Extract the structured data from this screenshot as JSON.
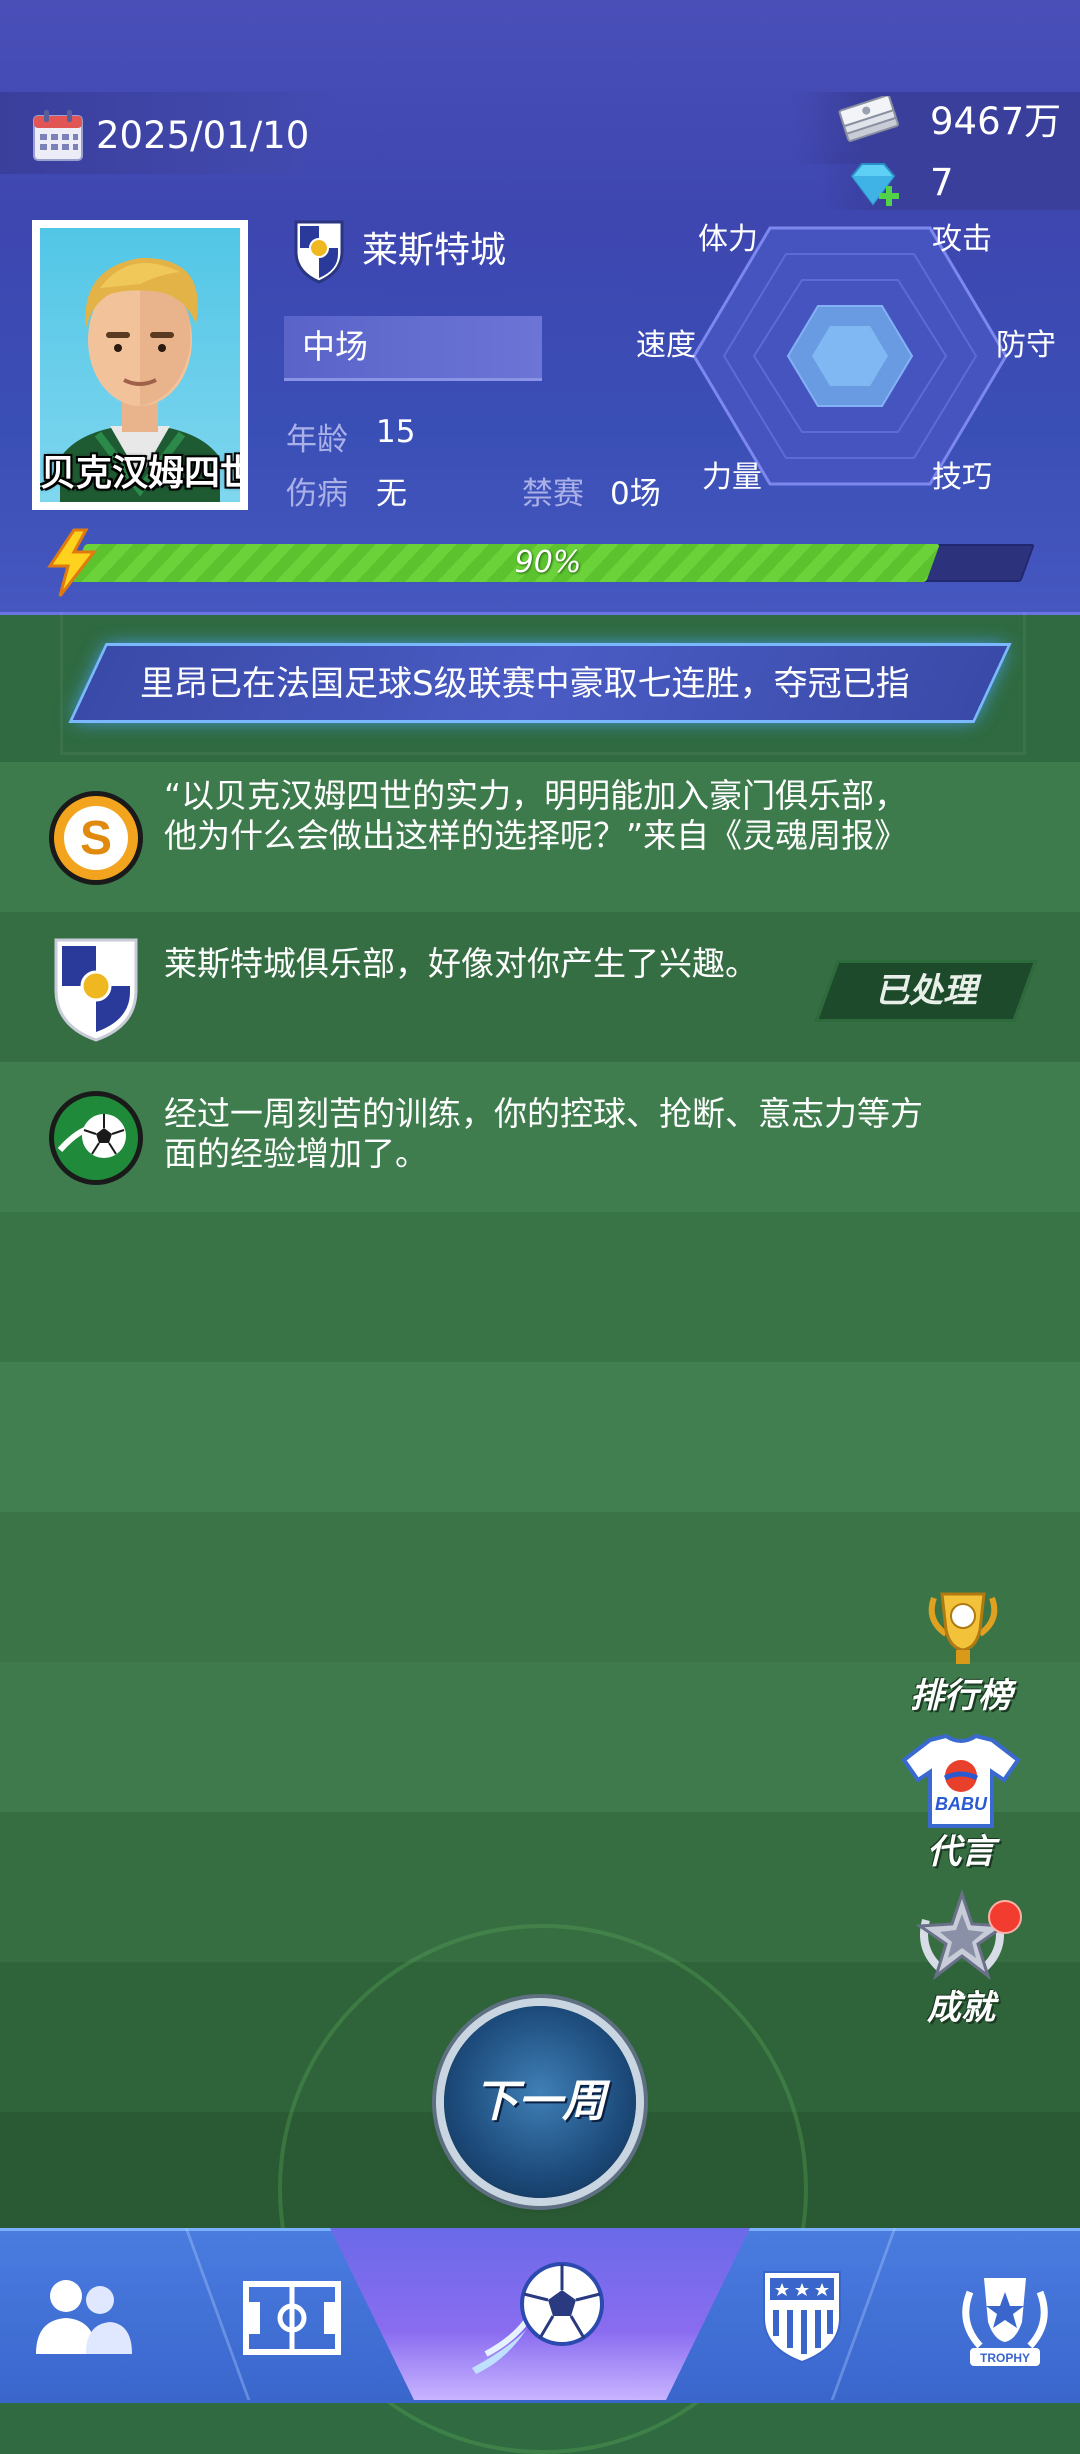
{
  "header": {
    "date": "2025/01/10",
    "cash": "9467万",
    "gems": "7"
  },
  "player": {
    "name": "贝克汉姆四世",
    "club": "莱斯特城",
    "position": "中场",
    "age_label": "年龄",
    "age": "15",
    "injury_label": "伤病",
    "injury": "无",
    "ban_label": "禁赛",
    "ban": "0场",
    "energy_percent": 90,
    "energy_text": "90%"
  },
  "stats": {
    "stamina": "体力",
    "attack": "攻击",
    "speed": "速度",
    "defense": "防守",
    "strength": "力量",
    "skill": "技巧"
  },
  "ticker": {
    "text": "里昂已在法国足球S级联赛中豪取七连胜，夺冠已指"
  },
  "messages": [
    {
      "icon": "s-newspaper-icon",
      "text": "“以贝克汉姆四世的实力，明明能加入豪门俱乐部，他为什么会做出这样的选择呢？”来自《灵魂周报》"
    },
    {
      "icon": "club-crest-icon",
      "text": "莱斯特城俱乐部，好像对你产生了兴趣。",
      "status": "已处理"
    },
    {
      "icon": "soccer-ball-icon",
      "text": "经过一周刻苦的训练，你的控球、抢断、意志力等方面的经验增加了。"
    }
  ],
  "side_buttons": {
    "ranking": "排行榜",
    "endorse": "代言",
    "endorse_logo": "BABU",
    "achievement": "成就"
  },
  "next_week": "下一周",
  "nav": {
    "trophy_text": "TROPHY",
    "tabs": [
      "team-icon",
      "pitch-icon",
      "match-icon",
      "league-icon",
      "trophy-icon"
    ]
  },
  "colors": {
    "header_bg": "#3e46b0",
    "field_green": "#2f6a40",
    "energy_green": "#6bd23a",
    "nav_blue": "#3a66cc",
    "badge_red": "#f23c30"
  }
}
